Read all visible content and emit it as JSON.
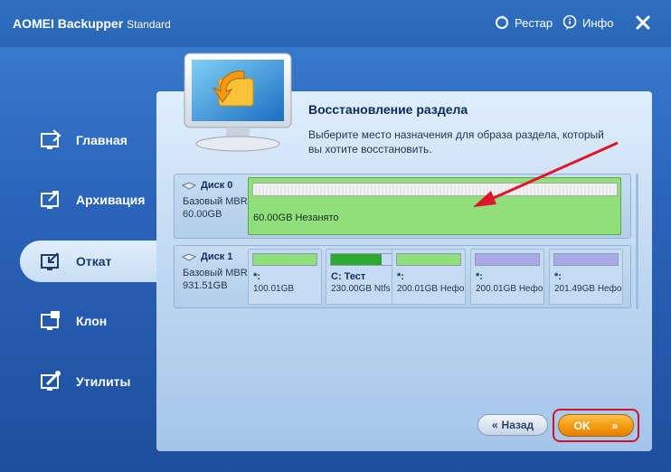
{
  "app": {
    "title": "AOMEI Backupper",
    "edition": "Standard"
  },
  "titlebar": {
    "restart_label": "Рестар",
    "info_label": "Инфо"
  },
  "sidebar": {
    "items": [
      {
        "label": "Главная",
        "icon": "home-icon"
      },
      {
        "label": "Архивация",
        "icon": "backup-icon"
      },
      {
        "label": "Откат",
        "icon": "restore-icon",
        "active": true
      },
      {
        "label": "Клон",
        "icon": "clone-icon"
      },
      {
        "label": "Утилиты",
        "icon": "tools-icon"
      }
    ]
  },
  "main": {
    "title": "Восстановление раздела",
    "description": "Выберите место назначения для образа раздела, который вы хотите восстановить."
  },
  "disks": [
    {
      "name": "Диск 0",
      "type": "Базовый MBR",
      "size": "60.00GB",
      "partitions": [
        {
          "label": "60.00GB Незанято",
          "selected": true
        }
      ]
    },
    {
      "name": "Диск 1",
      "type": "Базовый MBR",
      "size": "931.51GB",
      "partitions": [
        {
          "name": "*:",
          "info": "100.01GB",
          "fill": 1.0,
          "color": "#8fe07a"
        },
        {
          "name": "C: Тест",
          "info": "230.00GB Ntfs",
          "fill": 0.8,
          "color": "#2ea82e"
        },
        {
          "name": "*:",
          "info": "200.01GB Нефо",
          "fill": 1.0,
          "color": "#8fe07a"
        },
        {
          "name": "*:",
          "info": "200.01GB Нефо",
          "fill": 1.0,
          "color": "#a9a9e8"
        },
        {
          "name": "*:",
          "info": "201.49GB Нефо",
          "fill": 1.0,
          "color": "#a9a9e8"
        }
      ]
    }
  ],
  "buttons": {
    "back": "Назад",
    "ok": "OK"
  },
  "colors": {
    "accent": "#f39a10",
    "highlight": "#d3112b",
    "unallocated": "#8fe07a"
  }
}
